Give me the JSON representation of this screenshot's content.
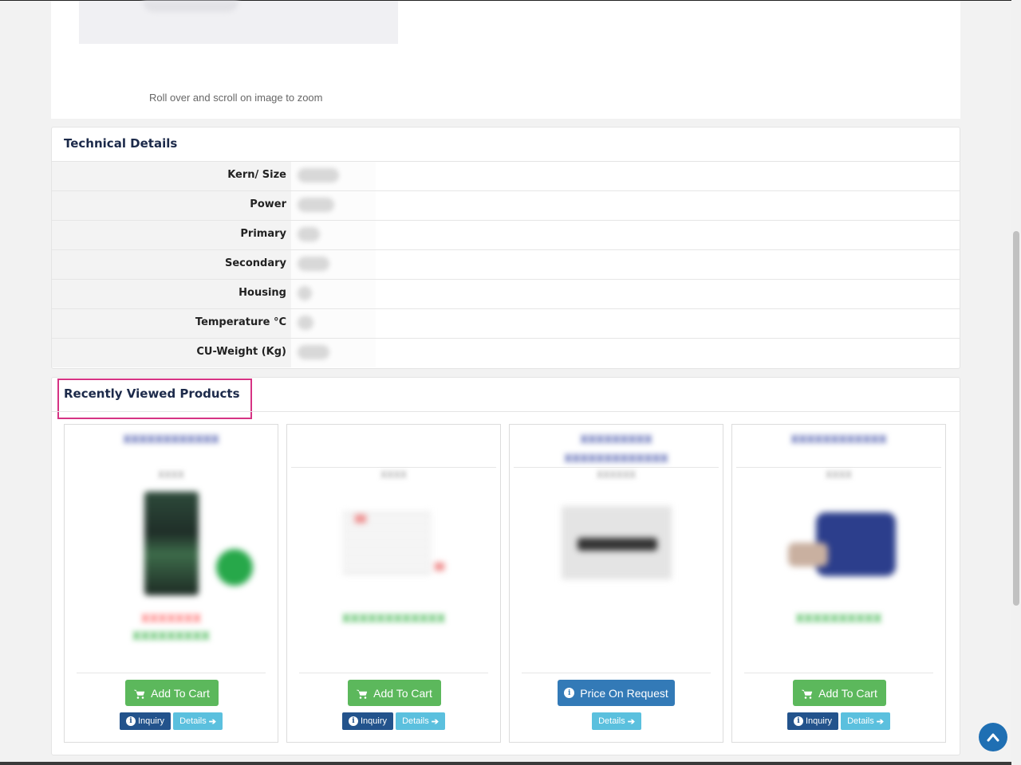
{
  "zoom_hint": "Roll over and scroll on image to zoom",
  "technical_details": {
    "title": "Technical Details",
    "rows": [
      {
        "label": "Kern/ Size",
        "value": ""
      },
      {
        "label": "Power",
        "value": ""
      },
      {
        "label": "Primary",
        "value": ""
      },
      {
        "label": "Secondary",
        "value": ""
      },
      {
        "label": "Housing",
        "value": ""
      },
      {
        "label": "Temperature °C",
        "value": ""
      },
      {
        "label": "CU-Weight (Kg)",
        "value": ""
      }
    ]
  },
  "recently_viewed": {
    "title": "Recently Viewed Products",
    "buttons": {
      "add_to_cart": "Add To Cart",
      "price_on_request": "Price On Request",
      "inquiry": "Inquiry",
      "details": "Details"
    }
  },
  "colors": {
    "title": "#1c2a4a",
    "add_to_cart": "#5cb85c",
    "price_on_request": "#337ab7",
    "inquiry": "#23538c",
    "details": "#5bc0de",
    "highlight": "#d63384"
  },
  "icons": {
    "cart": "shopping-cart-icon",
    "info": "info-circle-icon",
    "arrow": "arrow-right-icon",
    "back_to_top": "chevron-up-icon"
  }
}
